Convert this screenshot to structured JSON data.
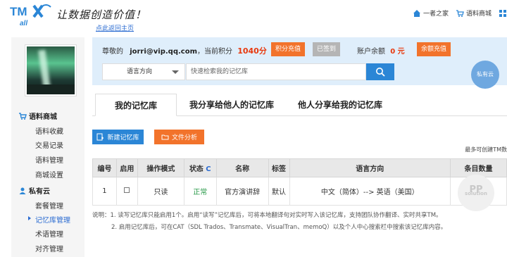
{
  "header": {
    "logo_text": "TMX all",
    "slogan": "让数据创造价值！",
    "home_link": "点此返回主页",
    "nav": [
      {
        "label": "一者之家",
        "icon": "home-icon"
      },
      {
        "label": "语料商城",
        "icon": "cart-icon"
      },
      {
        "label": "",
        "icon": "grid-icon"
      }
    ]
  },
  "sidebar": {
    "group1": {
      "label": "语料商城",
      "icon": "cart-icon"
    },
    "group1_items": [
      "语料收藏",
      "交易记录",
      "语料管理",
      "商城设置"
    ],
    "group2": {
      "label": "私有云",
      "icon": "user-icon"
    },
    "group2_items": [
      "套餐管理",
      "记忆库管理",
      "术语管理",
      "对齐管理"
    ],
    "active_item": "记忆库管理"
  },
  "account": {
    "greeting_prefix": "尊敬的",
    "email": "jorri@vip.qq.com",
    "points_prefix": "，当前积分",
    "points": "1040分",
    "points_recharge": "积分充值",
    "signed_in": "已签到",
    "balance_label": "账户余额",
    "balance": "0 元",
    "balance_recharge": "余额充值",
    "lang_select": "语言方向",
    "search_placeholder": "快速检索我的记忆库",
    "cloud_badge": "私有云"
  },
  "tabs": [
    {
      "label": "我的记忆库",
      "active": true
    },
    {
      "label": "我分享给他人的记忆库",
      "active": false
    },
    {
      "label": "他人分享给我的记忆库",
      "active": false
    }
  ],
  "actions": {
    "new_tm": "新建记忆库",
    "analyze": "文件分析",
    "limit_note": "最多可创建TM数"
  },
  "table": {
    "headers": [
      "编号",
      "启用",
      "操作模式",
      "状态",
      "名称",
      "标签",
      "语言方向",
      "条目数量"
    ],
    "status_refresh": "C",
    "rows": [
      {
        "id": "1",
        "mode": "只读",
        "status": "正常",
        "name": "官方演讲辞",
        "tag": "默认",
        "lang": "中文（简体）--> 英语（美国）",
        "count": "64"
      }
    ]
  },
  "notes": {
    "line1": "说明：1. 读写记忆库只能启用1个。启用“读写”记忆库后，可将本地翻译句对实时写入该记忆库，支持团队协作翻译、实时共享TM。",
    "line2": "2. 启用记忆库后，可在CAT（SDL Trados、Transmate、VisualTran、memoQ）以及个人中心搜索栏中搜索该记忆库内容。"
  },
  "watermark": {
    "big": "PP",
    "small": "solution"
  }
}
